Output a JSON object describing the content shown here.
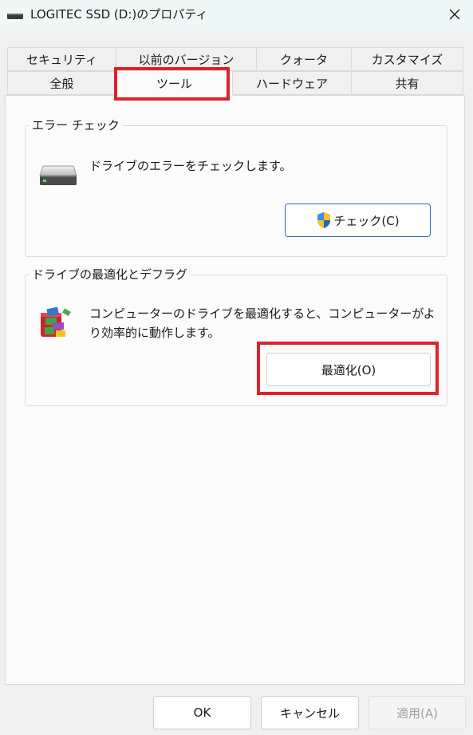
{
  "window": {
    "title": "LOGITEC SSD (D:)のプロパティ",
    "title_icon": "drive-icon",
    "close_icon": "close-icon"
  },
  "tabs_back": [
    "セキュリティ",
    "以前のバージョン",
    "クォータ",
    "カスタマイズ"
  ],
  "tabs_front": [
    "全般",
    "ツール",
    "ハードウェア",
    "共有"
  ],
  "selected_tab": "ツール",
  "error_check": {
    "group_label": "エラー チェック",
    "description": "ドライブのエラーをチェックします。",
    "button_label": "チェック(C)",
    "icon": "hard-drive-icon",
    "button_icon": "uac-shield-icon"
  },
  "optimize": {
    "group_label": "ドライブの最適化とデフラグ",
    "description_line1": "コンピューターのドライブを最適化すると、コンピューターがよ",
    "description_line2": "り効率的に動作します。",
    "button_label": "最適化(O)",
    "icon": "defrag-icon"
  },
  "footer": {
    "ok_label": "OK",
    "cancel_label": "キャンセル",
    "apply_label": "適用(A)"
  },
  "colors": {
    "highlight": "#e0202c",
    "title_bar": "#eef8f7",
    "primary_border": "#2c6cb5"
  }
}
